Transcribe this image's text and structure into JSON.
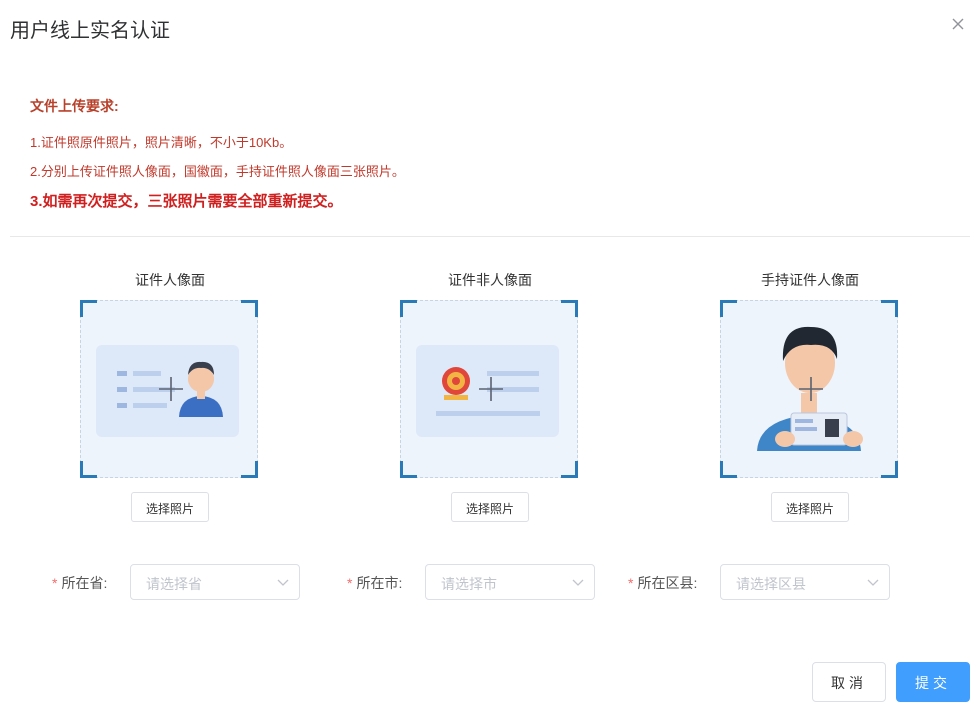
{
  "dialog": {
    "title": "用户线上实名认证",
    "close_icon": "close-icon"
  },
  "requirements": {
    "title": "文件上传要求:",
    "lines": [
      "1.证件照原件照片，照片清晰，不小于10Kb。",
      "2.分别上传证件照人像面，国徽面，手持证件照人像面三张照片。",
      "3.如需再次提交，三张照片需要全部重新提交。"
    ]
  },
  "uploads": [
    {
      "label": "证件人像面",
      "button": "选择照片",
      "illustration": "id-card-portrait-illustration"
    },
    {
      "label": "证件非人像面",
      "button": "选择照片",
      "illustration": "id-card-emblem-illustration"
    },
    {
      "label": "手持证件人像面",
      "button": "选择照片",
      "illustration": "person-holding-id-illustration"
    }
  ],
  "location": {
    "province": {
      "required_mark": "*",
      "label": "所在省:",
      "placeholder": "请选择省"
    },
    "city": {
      "required_mark": "*",
      "label": "所在市:",
      "placeholder": "请选择市"
    },
    "district": {
      "required_mark": "*",
      "label": "所在区县:",
      "placeholder": "请选择区县"
    }
  },
  "footer": {
    "cancel_label": "取消",
    "submit_label": "提交"
  },
  "colors": {
    "accent": "#409eff",
    "requirement_text": "#c0392b",
    "corner_bracket": "#2a7ab8",
    "upload_bg": "#eef4fc"
  }
}
